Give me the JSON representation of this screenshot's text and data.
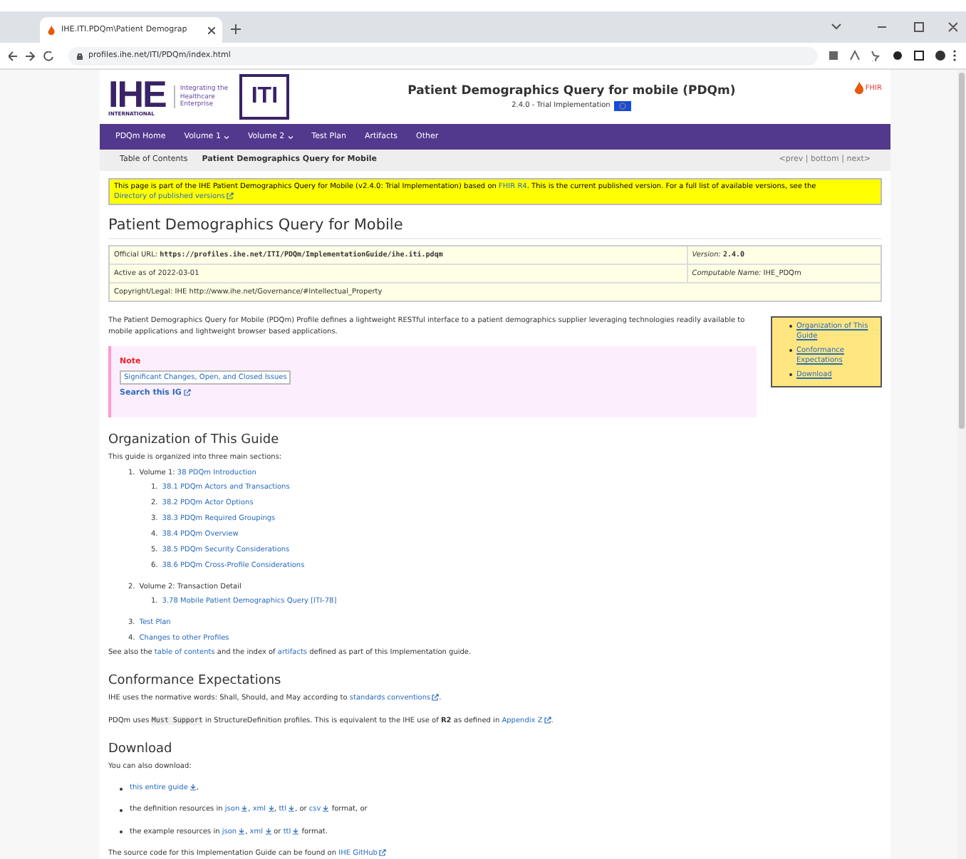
{
  "browser": {
    "tab_title": "IHE.ITI.PDQm\\Patient Demograp",
    "url": "profiles.ihe.net/ITI/PDQm/index.html"
  },
  "header": {
    "logo_text": "IHE",
    "logo_sub": "INTERNATIONAL",
    "tagline": "Integrating the Healthcare Enterprise",
    "domain": "ITI",
    "title": "Patient Demographics Query for mobile (PDQm)",
    "subtitle": "2.4.0 - Trial Implementation",
    "fhir": "FHIR"
  },
  "nav": [
    {
      "label": "PDQm Home",
      "menu": false
    },
    {
      "label": "Volume 1",
      "menu": true
    },
    {
      "label": "Volume 2",
      "menu": true
    },
    {
      "label": "Test Plan",
      "menu": false
    },
    {
      "label": "Artifacts",
      "menu": false
    },
    {
      "label": "Other",
      "menu": false
    }
  ],
  "breadcrumb": {
    "items": [
      "Table of Contents",
      "Patient Demographics Query for Mobile"
    ],
    "pager": "<prev | bottom | next>"
  },
  "banner": [
    {
      "kind": "text",
      "t": "This page is part of the IHE Patient Demographics Query for Mobile (v2.4.0: Trial Implementation) based on "
    },
    {
      "kind": "link",
      "t": "FHIR R4"
    },
    {
      "kind": "text",
      "t": ". This is the current published version. For a full list of available versions, see the "
    },
    {
      "kind": "ext_link",
      "t": "Directory of published versions"
    }
  ],
  "title": "Patient Demographics Query for Mobile",
  "meta": [
    {
      "cells": [
        {
          "label": "Official URL:",
          "value": "https://profiles.ihe.net/ITI/PDQm/ImplementationGuide/ihe.iti.pdqm",
          "mono": true
        },
        {
          "label": "Version:",
          "value": "2.4.0",
          "mono": true
        }
      ]
    },
    {
      "cells": [
        {
          "label": "Active as of",
          "value": "2022-03-01",
          "mono": false
        },
        {
          "label": "Computable Name:",
          "value": "IHE_PDQm",
          "mono": false
        }
      ]
    },
    {
      "cells": [
        {
          "label": "Copyright/Legal:",
          "value": "IHE http://www.ihe.net/Governance/#Intellectual_Property",
          "mono": false
        }
      ]
    }
  ],
  "intro": [
    {
      "kind": "text",
      "t": "The Patient Demographics Query for Mobile (PDQm) Profile defines a lightweight RESTful interface to a patient demographics supplier leveraging technologies readily available to mobile applications and lightweight browser based applications."
    }
  ],
  "toc_box": [
    "Organization of This Guide",
    "Conformance Expectations",
    "Download"
  ],
  "note": {
    "heading": "Note",
    "link": "Significant Changes, Open, and Closed Issues",
    "search": "Search this IG"
  },
  "organization": {
    "heading": "Organization of This Guide",
    "lead": "This guide is organized into three main sections:",
    "items": [
      {
        "number": "1.",
        "parts": [
          {
            "kind": "text",
            "t": "Volume 1: "
          },
          {
            "kind": "link",
            "t": "38 PDQm Introduction"
          }
        ],
        "children": [
          {
            "number": "1.",
            "t": "38.1 PDQm Actors and Transactions"
          },
          {
            "number": "2.",
            "t": "38.2 PDQm Actor Options"
          },
          {
            "number": "3.",
            "t": "38.3 PDQm Required Groupings"
          },
          {
            "number": "4.",
            "t": "38.4 PDQm Overview"
          },
          {
            "number": "5.",
            "t": "38.5 PDQm Security Considerations"
          },
          {
            "number": "6.",
            "t": "38.6 PDQm Cross-Profile Considerations"
          }
        ]
      },
      {
        "number": "2.",
        "parts": [
          {
            "kind": "text",
            "t": "Volume 2: Transaction Detail"
          }
        ],
        "children": [
          {
            "number": "1.",
            "t": "3.78 Mobile Patient Demographics Query [ITI-78]"
          }
        ]
      },
      {
        "number": "3.",
        "parts": [
          {
            "kind": "link",
            "t": "Test Plan"
          }
        ]
      },
      {
        "number": "4.",
        "parts": [
          {
            "kind": "link",
            "t": "Changes to other Profiles"
          }
        ]
      }
    ],
    "see_also": [
      {
        "kind": "text",
        "t": "See also the "
      },
      {
        "kind": "link",
        "t": "table of contents"
      },
      {
        "kind": "text",
        "t": " and the index of "
      },
      {
        "kind": "link",
        "t": "artifacts"
      },
      {
        "kind": "text",
        "t": " defined as part of this Implementation guide."
      }
    ]
  },
  "conformance": {
    "heading": "Conformance Expectations",
    "paragraphs": [
      [
        {
          "kind": "text",
          "t": "IHE uses the normative words: Shall, Should, and May according to "
        },
        {
          "kind": "ext_link",
          "t": "standards conventions"
        },
        {
          "kind": "text",
          "t": "."
        }
      ],
      [
        {
          "kind": "text",
          "t": "PDQm uses "
        },
        {
          "kind": "code",
          "t": "Must Support"
        },
        {
          "kind": "text",
          "t": " in StructureDefinition profiles. This is equivalent to the IHE use of "
        },
        {
          "kind": "strong",
          "t": "R2"
        },
        {
          "kind": "text",
          "t": " as defined in "
        },
        {
          "kind": "ext_link",
          "t": "Appendix Z"
        },
        {
          "kind": "text",
          "t": "."
        }
      ]
    ]
  },
  "download": {
    "heading": "Download",
    "lead": "You can also download:",
    "bullets": [
      [
        {
          "kind": "download_link",
          "t": "this entire guide"
        },
        {
          "kind": "text",
          "t": ","
        }
      ],
      [
        {
          "kind": "text",
          "t": "the definition resources in "
        },
        {
          "kind": "download_link",
          "t": "json"
        },
        {
          "kind": "text",
          "t": ", "
        },
        {
          "kind": "download_link",
          "t": "xml"
        },
        {
          "kind": "text",
          "t": ", "
        },
        {
          "kind": "download_link",
          "t": "ttl"
        },
        {
          "kind": "text",
          "t": ", or "
        },
        {
          "kind": "download_link",
          "t": "csv"
        },
        {
          "kind": "text",
          "t": " format, or"
        }
      ],
      [
        {
          "kind": "text",
          "t": "the example resources in "
        },
        {
          "kind": "download_link",
          "t": "json"
        },
        {
          "kind": "text",
          "t": ", "
        },
        {
          "kind": "download_link",
          "t": "xml"
        },
        {
          "kind": "text",
          "t": " or "
        },
        {
          "kind": "download_link",
          "t": "ttl"
        },
        {
          "kind": "text",
          "t": " format."
        }
      ]
    ],
    "source": [
      {
        "kind": "text",
        "t": "The source code for this Implementation Guide can be found on "
      },
      {
        "kind": "ext_link",
        "t": "IHE GitHub"
      }
    ]
  }
}
